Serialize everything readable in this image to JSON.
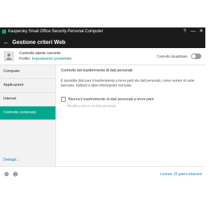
{
  "window": {
    "app_title": "Kaspersky Small Office Security Personal Computer",
    "controls": {
      "help": "?",
      "minimize": "—",
      "close": "✕"
    }
  },
  "header": {
    "back_icon": "←",
    "title": "Gestione criteri Web"
  },
  "user": {
    "name": "Controllo utente corrente",
    "profile_label": "Profilo:",
    "profile_value": "Impostazioni predefinite",
    "control_status": "Controllo disabilitato",
    "control_enabled": false
  },
  "sidebar": {
    "items": [
      {
        "label": "Computer"
      },
      {
        "label": "Applicazioni"
      },
      {
        "label": "Internet"
      },
      {
        "label": "Controllo contenuto",
        "active": true
      }
    ],
    "details_link": "Dettagli..."
  },
  "content": {
    "section_title": "Controllo del trasferimento di dati personali",
    "description": "È possibile bloccare il trasferimento a terze parti dei dati personali, come numeri di carte bancarie, indirizzi e altre informazioni riservate.",
    "checkbox_label": "Blocca il trasferimento di dati personali a terze parti",
    "checkbox_checked": false,
    "edit_link": "Modifica elenco di dati personali"
  },
  "footer": {
    "license_text": "Licenza: 32 giorni rimanenti",
    "icons": [
      "gear-icon",
      "support-icon"
    ]
  },
  "colors": {
    "accent": "#00a88e",
    "title_bar": "#1b1b1b",
    "link": "#0a7fb8"
  }
}
